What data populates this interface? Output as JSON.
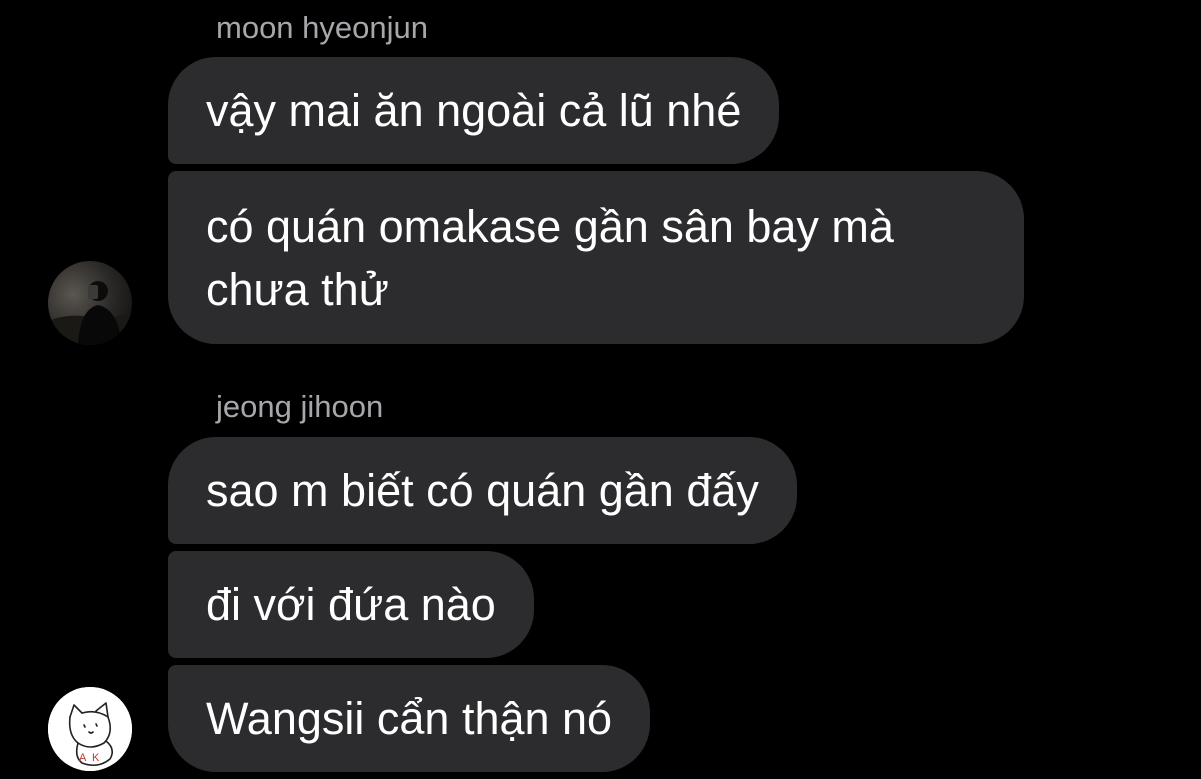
{
  "conversation": {
    "groups": [
      {
        "sender": "moon hyeonjun",
        "avatar_icon": "profile-photo-person-dark",
        "messages": [
          "vậy mai ăn ngoài cả lũ nhé",
          "có quán omakase gần sân bay mà chưa thử"
        ]
      },
      {
        "sender": "jeong jihoon",
        "avatar_icon": "profile-cat-drawing",
        "messages": [
          "sao m biết có quán gần đấy",
          "đi với đứa nào",
          "Wangsii cẩn thận nó"
        ]
      }
    ]
  },
  "colors": {
    "background": "#000000",
    "bubble": "#2c2c2e",
    "message_text": "#ffffff",
    "sender_name": "#a7a7ab"
  }
}
